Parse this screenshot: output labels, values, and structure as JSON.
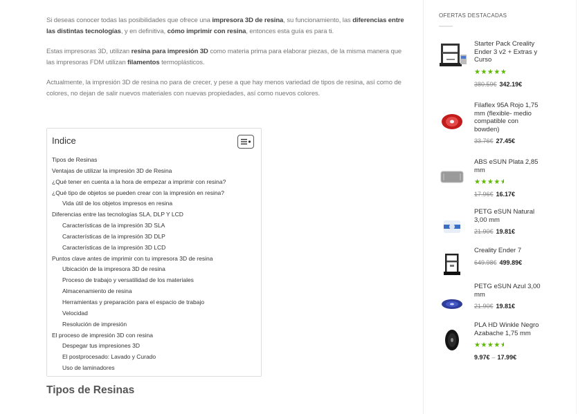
{
  "article": {
    "p1": {
      "t1": "Si deseas conocer todas las posibilidades que ofrece una ",
      "b1": "impresora 3D de resina",
      "t2": ", su funcionamiento, las ",
      "b2": "diferencias entre las distintas tecnologías",
      "t3": ", y en definitiva, ",
      "b3": "cómo imprimir con resina",
      "t4": ", entonces esta guía es para ti."
    },
    "p2": {
      "t1": "Estas impresoras 3D, utilizan ",
      "b1": "resina para impresión 3D",
      "t2": " como materia prima para elaborar piezas, de la misma manera que las impresoras FDM utilizan ",
      "b2": "filamentos",
      "t3": " termoplásticos."
    },
    "p3": "Actualmente, la impresión 3D de resina no para de crecer, y pese a que hay menos variedad de tipos de resina, así como de colores, no dejan de salir nuevos materiales con nuevas propiedades, así como nuevos colores.",
    "section_heading": "Tipos de Resinas"
  },
  "toc": {
    "title": "Indice",
    "toggle_icon": "list-toggle-icon",
    "items": [
      {
        "label": "Tipos de Resinas",
        "level": 1
      },
      {
        "label": "Ventajas de utilizar la impresión 3D de Resina",
        "level": 1
      },
      {
        "label": "¿Qué tener en cuenta a la hora de empezar a imprimir con resina?",
        "level": 1
      },
      {
        "label": "¿Qué tipo de objetos se pueden crear con la impresión en resina?",
        "level": 1
      },
      {
        "label": "Vida útil de los objetos impresos en resina",
        "level": 2
      },
      {
        "label": "Diferencias entre las tecnologías SLA, DLP Y LCD",
        "level": 1
      },
      {
        "label": "Características de la impresión 3D SLA",
        "level": 2
      },
      {
        "label": "Características de la impresión 3D DLP",
        "level": 2
      },
      {
        "label": "Características de la impresión 3D LCD",
        "level": 2
      },
      {
        "label": "Puntos clave antes de imprimir con tu impresora 3D de resina",
        "level": 1
      },
      {
        "label": "Ubicación de la impresora 3D de resina",
        "level": 2
      },
      {
        "label": "Proceso de trabajo y versatilidad de los materiales",
        "level": 2
      },
      {
        "label": "Almacenamiento de resina",
        "level": 2
      },
      {
        "label": "Herramientas y preparación para el espacio de trabajo",
        "level": 2
      },
      {
        "label": "Velocidad",
        "level": 2
      },
      {
        "label": "Resolución de impresión",
        "level": 2
      },
      {
        "label": "El proceso de impresión 3D con resina",
        "level": 1
      },
      {
        "label": "Despegar tus impresiones 3D",
        "level": 2
      },
      {
        "label": "El postprocesado: Lavado y Curado",
        "level": 2
      },
      {
        "label": "Uso de laminadores",
        "level": 2
      }
    ]
  },
  "sidebar": {
    "title": "OFERTAS DESTACADAS",
    "products": [
      {
        "name": "Starter Pack Creality Ender 3 v2 + Extras y Curso",
        "rating": 5,
        "old_price": "380.59€",
        "price": "342.19€",
        "icon": "3d-printer-kit-icon"
      },
      {
        "name": "Filaflex 95A Rojo 1,75 mm (flexible- medio compatible con bowden)",
        "rating": 0,
        "old_price": "33.76€",
        "price": "27.45€",
        "icon": "red-filament-spool-icon"
      },
      {
        "name": "ABS eSUN Plata 2,85 mm",
        "rating": 4.5,
        "old_price": "17.96€",
        "price": "16.17€",
        "icon": "silver-filament-spool-icon"
      },
      {
        "name": "PETG eSUN Natural 3,00 mm",
        "rating": 0,
        "old_price": "21.90€",
        "price": "19.81€",
        "icon": "natural-filament-spool-icon"
      },
      {
        "name": "Creality Ender 7",
        "rating": 0,
        "old_price": "649.98€",
        "price": "499.89€",
        "icon": "3d-printer-icon"
      },
      {
        "name": "PETG eSUN Azul 3,00 mm",
        "rating": 0,
        "old_price": "21.90€",
        "price": "19.81€",
        "icon": "blue-filament-spool-icon"
      },
      {
        "name": "PLA HD Winkle Negro Azabache 1,75 mm",
        "rating": 4.5,
        "old_price": "",
        "price_from": "9.97€",
        "price_to": "17.99€",
        "price_range_separator": "–",
        "icon": "black-filament-spool-icon"
      }
    ]
  },
  "colors": {
    "star_green": "#5cb800",
    "text_gray": "#777777",
    "heading_dark": "#333333"
  }
}
